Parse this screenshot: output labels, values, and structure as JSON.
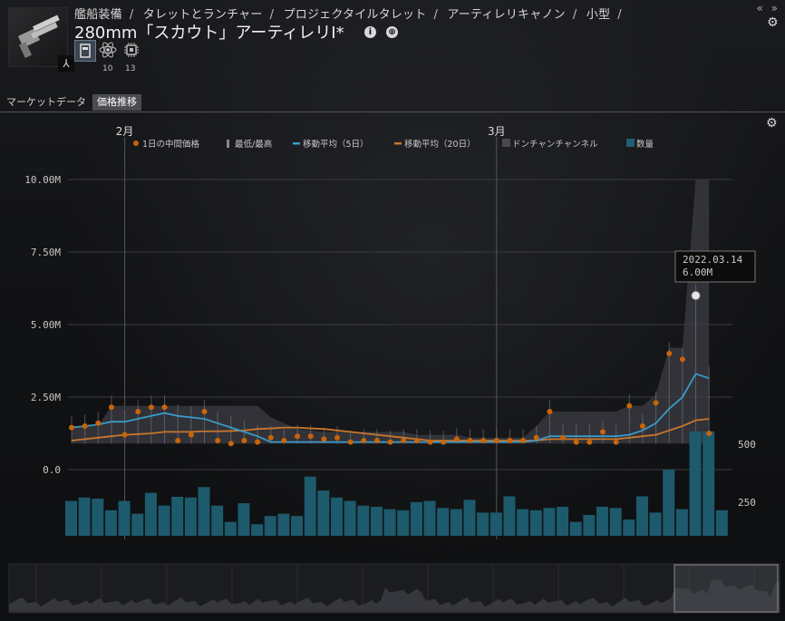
{
  "header": {
    "breadcrumb": [
      "艦船装備",
      "タレットとランチャー",
      "プロジェクタイルタレット",
      "アーティレリキャノン",
      "小型"
    ],
    "title": "280mm「スカウト」アーティレリI*",
    "sub_counts": [
      "10",
      "13"
    ],
    "controls": [
      "«",
      "»"
    ]
  },
  "tabs": [
    {
      "label": "マーケットデータ",
      "active": false
    },
    {
      "label": "価格推移",
      "active": true
    }
  ],
  "legend": [
    {
      "label": "1日の中間価格",
      "color": "#c8650a",
      "shape": "dot"
    },
    {
      "label": "最低/最高",
      "color": "#8a8a8a",
      "shape": "bar"
    },
    {
      "label": "移動平均（5日）",
      "color": "#3a9ac8",
      "shape": "line"
    },
    {
      "label": "移動平均（20日）",
      "color": "#c8762a",
      "shape": "line"
    },
    {
      "label": "ドンチャンチャンネル",
      "color": "#4a4a4e",
      "shape": "square"
    },
    {
      "label": "数量",
      "color": "#1f5e70",
      "shape": "square"
    }
  ],
  "tooltip": {
    "date": "2022.03.14",
    "value": "6.00M"
  },
  "chart_data": {
    "type": "line",
    "x_months": [
      {
        "label": "2月",
        "index": 4
      },
      {
        "label": "3月",
        "index": 32
      }
    ],
    "y_ticks": [
      "10.00M",
      "7.50M",
      "5.00M",
      "2.50M",
      "0.0"
    ],
    "y_range": [
      0,
      10000000
    ],
    "volume_ticks": [
      "500",
      "250"
    ],
    "volume_range": [
      0,
      500
    ],
    "median": [
      1.45,
      1.5,
      1.6,
      2.15,
      1.2,
      2.0,
      2.15,
      2.15,
      1.0,
      1.2,
      2.0,
      1.0,
      0.9,
      1.0,
      0.95,
      1.1,
      1.0,
      1.15,
      1.15,
      1.05,
      1.1,
      0.95,
      1.0,
      1.0,
      0.95,
      1.0,
      1.0,
      0.95,
      0.95,
      1.05,
      1.0,
      1.0,
      1.0,
      1.0,
      1.0,
      1.1,
      2.0,
      1.1,
      0.95,
      0.95,
      1.3,
      0.95,
      2.2,
      1.5,
      2.3,
      4.0,
      3.8,
      6.0,
      1.25
    ],
    "ma5": [
      1.45,
      1.5,
      1.55,
      1.65,
      1.65,
      1.75,
      1.85,
      1.95,
      1.85,
      1.8,
      1.75,
      1.6,
      1.45,
      1.3,
      1.15,
      0.95,
      0.95,
      0.95,
      0.95,
      0.95,
      0.95,
      0.95,
      0.95,
      0.95,
      0.95,
      0.95,
      0.95,
      0.95,
      0.95,
      0.95,
      0.95,
      0.95,
      0.95,
      0.95,
      0.95,
      1.0,
      1.15,
      1.15,
      1.15,
      1.15,
      1.15,
      1.15,
      1.2,
      1.35,
      1.6,
      2.1,
      2.5,
      3.3,
      3.15
    ],
    "ma20": [
      1.0,
      1.05,
      1.1,
      1.15,
      1.2,
      1.22,
      1.25,
      1.3,
      1.3,
      1.3,
      1.32,
      1.32,
      1.33,
      1.35,
      1.4,
      1.42,
      1.45,
      1.45,
      1.42,
      1.4,
      1.35,
      1.3,
      1.25,
      1.2,
      1.15,
      1.1,
      1.05,
      1.0,
      1.0,
      1.0,
      1.0,
      1.0,
      1.0,
      1.0,
      1.0,
      1.0,
      1.05,
      1.05,
      1.05,
      1.05,
      1.05,
      1.05,
      1.1,
      1.15,
      1.2,
      1.35,
      1.5,
      1.7,
      1.75
    ],
    "donchian_high": [
      1.5,
      1.5,
      1.5,
      2.2,
      2.2,
      2.2,
      2.2,
      2.2,
      2.2,
      2.2,
      2.2,
      2.2,
      2.2,
      2.2,
      2.2,
      1.8,
      1.6,
      1.4,
      1.35,
      1.3,
      1.3,
      1.3,
      1.3,
      1.3,
      1.3,
      1.3,
      1.2,
      1.2,
      1.2,
      1.2,
      1.1,
      1.1,
      1.1,
      1.1,
      1.1,
      1.5,
      2.0,
      2.0,
      2.0,
      2.0,
      2.0,
      2.0,
      2.2,
      2.2,
      2.6,
      4.2,
      4.2,
      10.0,
      10.0
    ],
    "donchian_low": [
      0.9,
      0.9,
      0.9,
      0.9,
      0.9,
      0.9,
      0.9,
      0.9,
      0.9,
      0.9,
      0.9,
      0.9,
      0.9,
      0.9,
      0.9,
      0.9,
      0.9,
      0.9,
      0.9,
      0.9,
      0.9,
      0.9,
      0.9,
      0.9,
      0.9,
      0.9,
      0.9,
      0.9,
      0.9,
      0.9,
      0.9,
      0.9,
      0.9,
      0.9,
      0.9,
      0.9,
      0.9,
      0.9,
      0.9,
      0.9,
      0.9,
      0.9,
      0.9,
      0.9,
      0.9,
      0.9,
      0.9,
      0.9,
      0.9
    ],
    "volume": [
      150,
      165,
      160,
      110,
      150,
      95,
      185,
      130,
      168,
      165,
      210,
      130,
      60,
      140,
      50,
      85,
      95,
      85,
      255,
      195,
      165,
      150,
      130,
      125,
      115,
      110,
      145,
      150,
      120,
      115,
      155,
      100,
      100,
      170,
      115,
      110,
      120,
      125,
      60,
      90,
      125,
      120,
      70,
      170,
      100,
      285,
      115,
      1050,
      1050,
      110
    ],
    "value_unit": "M",
    "highlight_index": 47
  }
}
